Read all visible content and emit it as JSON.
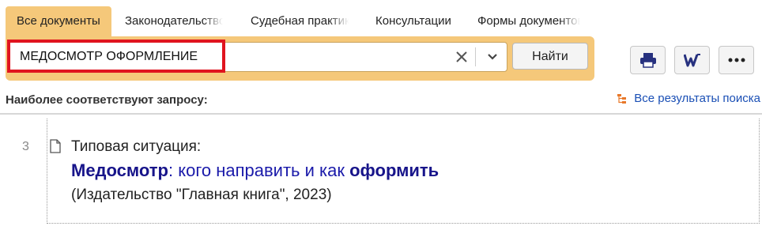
{
  "tabs": [
    {
      "label": "Все документы",
      "active": true
    },
    {
      "label": "Законодательство",
      "active": false
    },
    {
      "label": "Судебная практика",
      "active": false
    },
    {
      "label": "Консультации",
      "active": false
    },
    {
      "label": "Формы документов",
      "active": false
    }
  ],
  "search": {
    "query": "МЕДОСМОТР ОФОРМЛЕНИЕ",
    "find_label": "Найти"
  },
  "toolbar": {
    "icons": [
      "printer-icon",
      "word-export-icon",
      "more-icon"
    ]
  },
  "results": {
    "header": "Наиболее соответствуют запросу:",
    "all_results_link": "Все результаты поиска",
    "items": [
      {
        "number": "3",
        "kind": "Типовая ситуация:",
        "title_part1": "Медосмотр",
        "title_part2": ": кого направить и как ",
        "title_part3": "оформить",
        "source": "(Издательство \"Главная книга\", 2023)"
      }
    ]
  },
  "colors": {
    "accent": "#f5c87a",
    "highlight_border": "#e0141e",
    "link": "#1a1aaa"
  }
}
